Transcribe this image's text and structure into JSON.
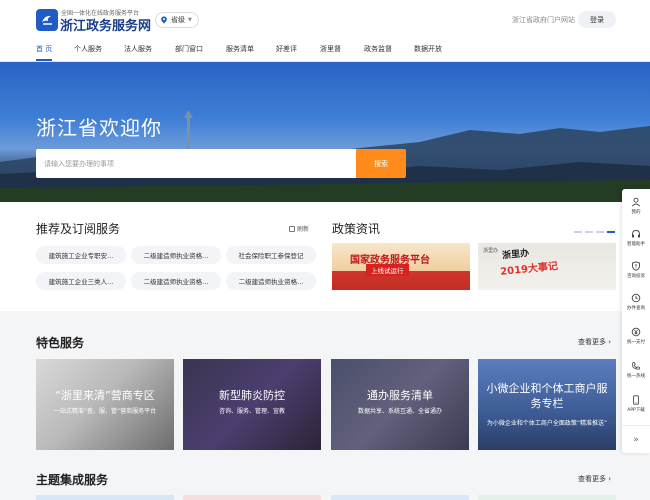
{
  "header": {
    "brand_subtitle": "全国一体化在线政务服务平台",
    "brand_title": "浙江政务服务网",
    "region": "省级",
    "portal_link": "浙江省政府门户网站",
    "login": "登录"
  },
  "nav": {
    "items": [
      "首 页",
      "个人服务",
      "法人服务",
      "部门窗口",
      "服务清单",
      "好差评",
      "浙里督",
      "政务监督",
      "数据开放"
    ],
    "active_index": 0
  },
  "hero": {
    "title": "浙江省欢迎你",
    "search_placeholder": "请输入您要办理的事项",
    "search_button": "搜索"
  },
  "recommend": {
    "title": "推荐及订阅服务",
    "refresh": "刷新",
    "chips": [
      "建筑施工企业专职安...",
      "二级建造师执业资格...",
      "社会保险职工参保登记",
      "建筑施工企业三类人...",
      "二级建造师执业资格...",
      "二级建造师执业资格..."
    ]
  },
  "news": {
    "title": "政策资讯",
    "card1_big": "国家政务服务平台",
    "card1_small": "上线试运行",
    "card2_stamp": "浙里办",
    "card2_year": "2019大事记",
    "card2_logo": "浙里办"
  },
  "featured": {
    "title": "特色服务",
    "more": "查看更多",
    "cards": [
      {
        "title": "“浙里来清”营商专区",
        "sub": "一站式精准“查、服、管”营商服务平台"
      },
      {
        "title": "新型肺炎防控",
        "sub": "咨询、服务、管理、宣教"
      },
      {
        "title": "通办服务清单",
        "sub": "数据共享、系统互通、全省通办"
      },
      {
        "title": "小微企业和个体工商户服务专栏",
        "sub": "为小微企业和个体工商户全面政策“精准推送”"
      }
    ]
  },
  "themes": {
    "title": "主题集成服务",
    "more": "查看更多"
  },
  "toolbar": {
    "items": [
      "我的",
      "智能助手",
      "咨询投诉",
      "办件查询",
      "统一支付",
      "统一热线",
      "APP下载"
    ]
  }
}
